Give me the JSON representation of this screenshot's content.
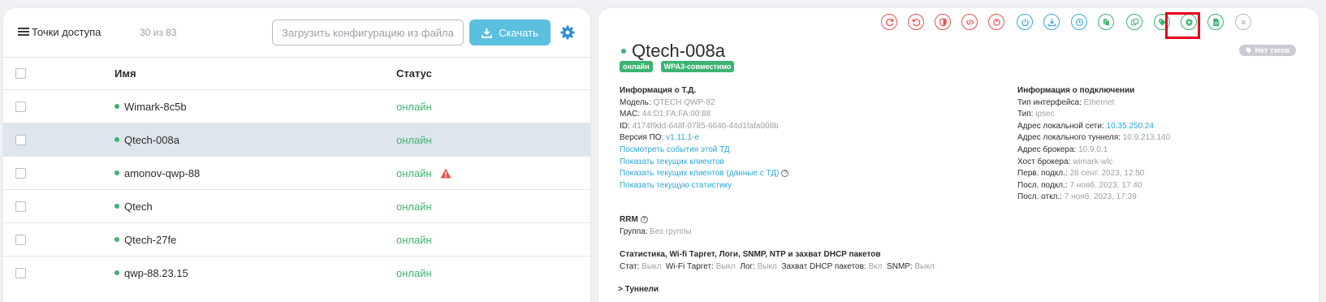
{
  "left": {
    "title": "Точки доступа",
    "count": "30 из 83",
    "upload_label": "Загрузить конфигурацию из файла",
    "download_label": "Скачать",
    "columns": {
      "name": "Имя",
      "status": "Статус"
    },
    "rows": [
      {
        "name": "Wimark-8c5b",
        "status": "онлайн",
        "warning": false
      },
      {
        "name": "Qtech-008a",
        "status": "онлайн",
        "warning": false,
        "selected": true
      },
      {
        "name": "amonov-qwp-88",
        "status": "онлайн",
        "warning": true
      },
      {
        "name": "Qtech",
        "status": "онлайн",
        "warning": false
      },
      {
        "name": "Qtech-27fe",
        "status": "онлайн",
        "warning": false
      },
      {
        "name": "qwp-88.23.15",
        "status": "онлайн",
        "warning": false
      }
    ]
  },
  "right": {
    "ap_name": "Qtech-008a",
    "badges": [
      "онлайн",
      "WPA3-совместимо"
    ],
    "tags_label": "Нет тэгов",
    "toolbar_icons": [
      "refresh-icon",
      "undo-icon",
      "shield-icon",
      "code-icon",
      "power-off-icon",
      "power-icon",
      "download-icon",
      "clock-icon",
      "copy-icon",
      "clone-icon",
      "tag-icon",
      "add-icon",
      "document-icon",
      "close-icon"
    ],
    "ap_info": {
      "heading": "Информация о Т.Д.",
      "model_label": "Модель:",
      "model": "QTECH QWP-82",
      "mac_label": "MAC:",
      "mac": "44:D1:FA:FA:00:88",
      "id_label": "ID:",
      "id": "4174f9dd-648f-0785-6640-44d1fafa008b",
      "fw_label": "Версия ПО:",
      "fw": "v1.11.1-e",
      "link_events": "Посмотреть события этой ТД",
      "link_clients": "Показать текущих клиентов",
      "link_clients_ap": "Показать текущих клиентов (данные с ТД)",
      "link_stats": "Показать текущую статистику"
    },
    "conn_info": {
      "heading": "Информация о подключении",
      "iface_label": "Тип интерфейса:",
      "iface": "Ethernet",
      "type_label": "Тип:",
      "type": "ipsec",
      "lan_label": "Адрес локальной сети:",
      "lan": "10.35.250.24",
      "tunnel_label": "Адрес локального туннеля:",
      "tunnel": "10.9.213.140",
      "broker_label": "Адрес брокера:",
      "broker": "10.9.0.1",
      "broker_host_label": "Хост брокера:",
      "broker_host": "wimark-wlc",
      "first_conn_label": "Перв. подкл.:",
      "first_conn": "28 сент. 2023, 12:50",
      "last_conn_label": "Посл. подкл.:",
      "last_conn": "7 нояб. 2023, 17:40",
      "last_disc_label": "Посл. откл.:",
      "last_disc": "7 нояб. 2023, 17:39"
    },
    "rrm": {
      "heading": "RRM",
      "group_label": "Группа:",
      "group": "Без группы"
    },
    "stats": {
      "heading": "Статистика, Wi-fi Таргет, Логи, SNMP, NTP и захват DHCP пакетов",
      "stat_label": "Стат:",
      "stat": "Выкл",
      "wifi_label": "Wi-Fi Таргет:",
      "wifi": "Выкл",
      "log_label": "Лог:",
      "log": "Выкл",
      "dhcp_label": "Захват DHCP пакетов:",
      "dhcp": "Вкл",
      "snmp_label": "SNMP:",
      "snmp": "Выкл"
    },
    "tunnels_label": "Туннели"
  },
  "colors": {
    "online": "#3cb371",
    "accent": "#5bc0de",
    "link": "#2aa6d6",
    "highlight": "#e8001c"
  }
}
